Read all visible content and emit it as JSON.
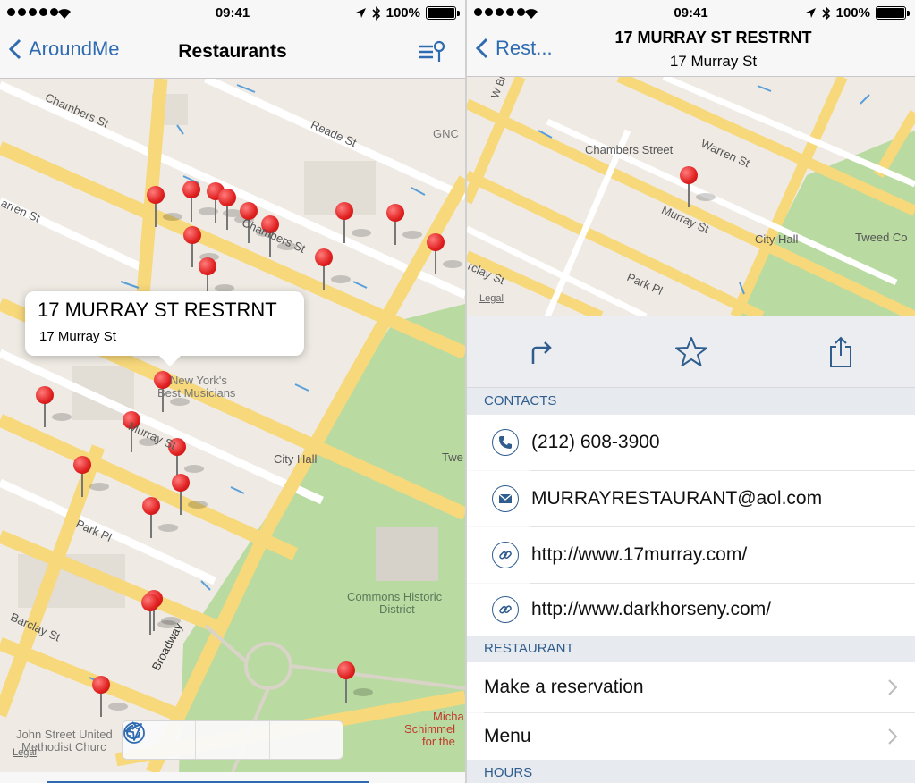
{
  "status_bar": {
    "time": "09:41",
    "battery": "100%"
  },
  "left": {
    "nav": {
      "back_label": "AroundMe",
      "title": "Restaurants"
    },
    "callout": {
      "title": "17 MURRAY ST RESTRNT",
      "subtitle": "17 Murray St"
    },
    "map_labels": {
      "chambers_st": "Chambers St",
      "reade_st": "Reade St",
      "gnc": "GNC",
      "warren_st": "arren St",
      "chambers_st_2": "Chambers St",
      "new_yorks": "New York's",
      "best_musicians": "Best Musicians",
      "murray_st": "Murray St",
      "city_hall": "City Hall",
      "twe": "Twe",
      "park_pl": "Park Pl",
      "commons_historic": "Commons Historic",
      "district": "District",
      "barclay_st": "Barclay St",
      "broadway": "Broadway",
      "john_street_united": "John Street United",
      "methodist_church": "Methodist Churc",
      "michael": "Micha",
      "schimmel": "Schimmel",
      "for_the": "for the",
      "legal": "Legal"
    },
    "toolbar": [
      "locate-icon",
      "fit-pins-icon",
      "refresh-icon"
    ]
  },
  "right": {
    "nav": {
      "back_label": "Rest...",
      "title": "17 MURRAY ST RESTRNT",
      "subtitle": "17 Murray St"
    },
    "map_labels": {
      "w_br": "W Br",
      "chambers_street": "Chambers Street",
      "warren_st": "Warren St",
      "murray_st": "Murray St",
      "city_hall": "City Hall",
      "tweed_co": "Tweed Co",
      "barclay_st": "rclay St",
      "park_pl": "Park Pl",
      "legal": "Legal"
    },
    "actions": [
      "directions-icon",
      "favorite-star-icon",
      "share-icon"
    ],
    "contacts_header": "CONTACTS",
    "contacts": [
      {
        "icon": "phone-icon",
        "text": "(212) 608-3900"
      },
      {
        "icon": "mail-icon",
        "text": "MURRAYRESTAURANT@aol.com"
      },
      {
        "icon": "link-icon",
        "text": "http://www.17murray.com/"
      },
      {
        "icon": "link-icon",
        "text": "http://www.darkhorseny.com/"
      }
    ],
    "restaurant_header": "RESTAURANT",
    "restaurant_rows": [
      "Make a reservation",
      "Menu"
    ],
    "hours_header": "HOURS"
  },
  "colors": {
    "accent": "#2f6bb0",
    "section_text": "#2f5d8e",
    "pin": "#e02020",
    "road_major": "#f7d87a",
    "park": "#b9dba1"
  }
}
